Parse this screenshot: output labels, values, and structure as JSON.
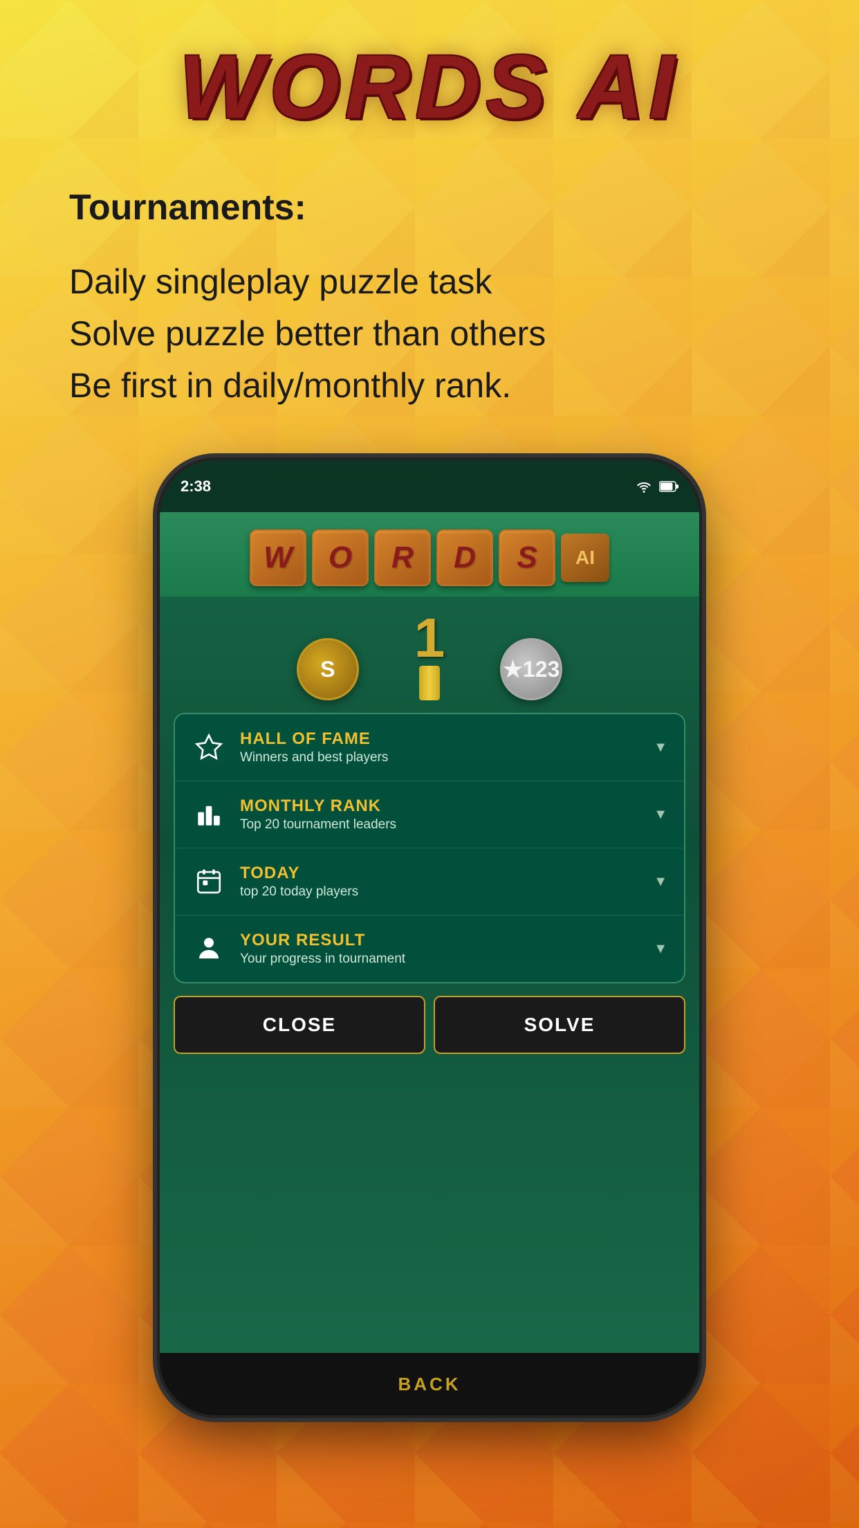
{
  "app": {
    "title": "WORDS AI"
  },
  "description": {
    "tournaments_label": "Tournaments:",
    "line1": "Daily singleplay puzzle task",
    "line2": "Solve puzzle better than others",
    "line3": "Be first in daily/monthly rank."
  },
  "phone": {
    "status_time": "2:38",
    "game_tiles": [
      "W",
      "O",
      "R",
      "D",
      "S"
    ],
    "ai_label": "AI",
    "trophy_number": "1",
    "back_label": "BACK"
  },
  "menu": {
    "items": [
      {
        "title": "HALL OF FAME",
        "subtitle": "Winners and best players",
        "icon": "star"
      },
      {
        "title": "MONTHLY RANK",
        "subtitle": "Top 20 tournament leaders",
        "icon": "chart"
      },
      {
        "title": "TODAY",
        "subtitle": "top 20 today players",
        "icon": "calendar"
      },
      {
        "title": "Your result",
        "subtitle": "Your progress in tournament",
        "icon": "person"
      }
    ],
    "close_btn": "CLOSE",
    "solve_btn": "SOLVE"
  }
}
